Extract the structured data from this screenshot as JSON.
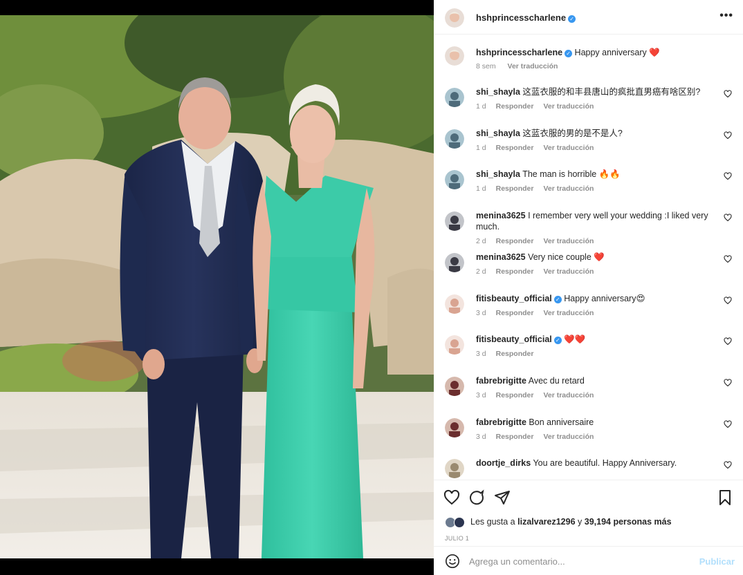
{
  "post": {
    "author": "hshprincesscharlene",
    "caption": "Happy anniversary",
    "caption_emoji": "❤️",
    "caption_time": "8 sem",
    "translate_label": "Ver traducción"
  },
  "comments": [
    {
      "user": "shi_shayla",
      "verified": false,
      "text": "这蓝衣服的和丰县唐山的疯批直男癌有啥区别?",
      "time": "1 d",
      "reply": "Responder",
      "translate": "Ver traducción"
    },
    {
      "user": "shi_shayla",
      "verified": false,
      "text": "这蓝衣服的男的是不是人?",
      "time": "1 d",
      "reply": "Responder",
      "translate": "Ver traducción"
    },
    {
      "user": "shi_shayla",
      "verified": false,
      "text": "The man is horrible 🔥🔥",
      "time": "1 d",
      "reply": "Responder",
      "translate": "Ver traducción"
    },
    {
      "user": "menina3625",
      "verified": false,
      "text": "I remember very well your wedding :I liked very much.",
      "time": "2 d",
      "reply": "Responder",
      "translate": "Ver traducción"
    },
    {
      "user": "menina3625",
      "verified": false,
      "text": "Very nice couple ❤️",
      "time": "2 d",
      "reply": "Responder",
      "translate": "Ver traducción"
    },
    {
      "user": "fitisbeauty_official",
      "verified": true,
      "text": "Happy anniversary😍",
      "time": "3 d",
      "reply": "Responder",
      "translate": "Ver traducción"
    },
    {
      "user": "fitisbeauty_official",
      "verified": true,
      "text": "❤️❤️",
      "time": "3 d",
      "reply": "Responder",
      "translate": ""
    },
    {
      "user": "fabrebrigitte",
      "verified": false,
      "text": "Avec du retard",
      "time": "3 d",
      "reply": "Responder",
      "translate": "Ver traducción"
    },
    {
      "user": "fabrebrigitte",
      "verified": false,
      "text": "Bon anniversaire",
      "time": "3 d",
      "reply": "Responder",
      "translate": "Ver traducción"
    },
    {
      "user": "doortje_dirks",
      "verified": false,
      "text": "You are beautiful. Happy Anniversary.",
      "time": "",
      "reply": "",
      "translate": ""
    }
  ],
  "likes": {
    "prefix": "Les gusta a",
    "user": "lizalvarez1296",
    "middle": "y",
    "count": "39,194 personas más"
  },
  "date": "JULIO 1",
  "add_comment": {
    "placeholder": "Agrega un comentario...",
    "publish": "Publicar"
  },
  "colors": {
    "link_blue": "#3897f0",
    "like_red": "#ed4956",
    "muted": "#8e8e8e",
    "publish_disabled": "#b2dffc"
  }
}
